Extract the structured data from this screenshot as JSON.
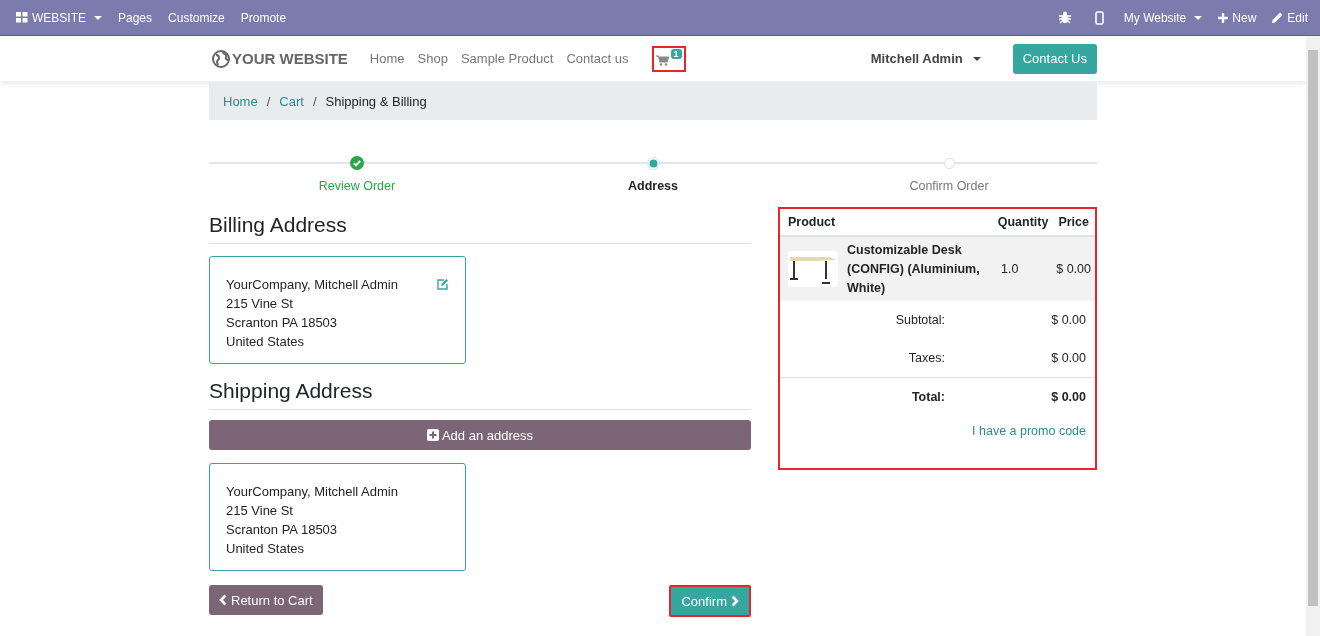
{
  "topbar": {
    "app_menu": "WEBSITE",
    "items": [
      "Pages",
      "Customize",
      "Promote"
    ],
    "website": "My Website",
    "new": "New",
    "edit": "Edit"
  },
  "header": {
    "logo": "YOUR WEBSITE",
    "nav": [
      "Home",
      "Shop",
      "Sample Product",
      "Contact us"
    ],
    "cart_count": "1",
    "cart_highlighted": true,
    "user": "Mitchell Admin",
    "contact_button": "Contact Us"
  },
  "breadcrumb": [
    {
      "kind": "link",
      "label": "Home"
    },
    {
      "kind": "separator",
      "label": "/"
    },
    {
      "kind": "link",
      "label": "Cart"
    },
    {
      "kind": "separator",
      "label": "/"
    },
    {
      "kind": "current",
      "label": "Shipping & Billing"
    }
  ],
  "steps": [
    {
      "label": "Review Order",
      "done": true,
      "selected": false
    },
    {
      "label": "Address",
      "done": false,
      "selected": true
    },
    {
      "label": "Confirm Order",
      "done": false,
      "selected": false
    }
  ],
  "billing": {
    "title": "Billing Address",
    "lines": [
      "YourCompany, Mitchell Admin",
      "215 Vine St",
      "Scranton PA 18503",
      "United States"
    ]
  },
  "shipping": {
    "title": "Shipping Address",
    "add_button": "Add an address",
    "lines": [
      "YourCompany, Mitchell Admin",
      "215 Vine St",
      "Scranton PA 18503",
      "United States"
    ]
  },
  "return_button": "Return to Cart",
  "confirm_button": "Confirm",
  "confirm_highlighted": true,
  "summary": {
    "highlighted": true,
    "columns": [
      "Product",
      "Quantity",
      "Price"
    ],
    "rows": [
      {
        "product": "Customizable Desk (CONFIG) (Aluminium, White)",
        "quantity": "1.0",
        "price": "$ 0.00"
      }
    ],
    "totals": [
      {
        "label": "Subtotal:",
        "value": "$ 0.00",
        "bold": false
      },
      {
        "label": "Taxes:",
        "value": "$ 0.00",
        "bold": false
      },
      {
        "label": "Total:",
        "value": "$ 0.00",
        "bold": true
      }
    ],
    "promo": "I have a promo code"
  }
}
